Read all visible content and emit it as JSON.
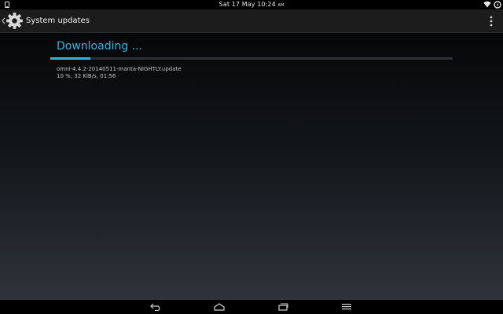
{
  "status_bar": {
    "time_text": "Sat 17 May 10:24",
    "ampm": "AM",
    "icons": [
      "phone-icon",
      "wifi-icon",
      "battery-charging-icon"
    ]
  },
  "action_bar": {
    "title": "System updates",
    "icons": [
      "back-chevron-icon",
      "settings-gear-icon",
      "overflow-menu-icon"
    ]
  },
  "download": {
    "heading": "Downloading ...",
    "filename": "omni-4.4.2-20140511-manta-NIGHTLY.update",
    "progress_text": "10 %, 32 KiB/s, 01:56",
    "progress_percent": 10
  },
  "nav_bar": {
    "buttons": [
      "back-icon",
      "home-icon",
      "recents-icon",
      "menu-icon"
    ]
  },
  "colors": {
    "accent": "#33b5e5",
    "text_primary": "#f2f2f2",
    "text_secondary": "#c8c8c8"
  }
}
